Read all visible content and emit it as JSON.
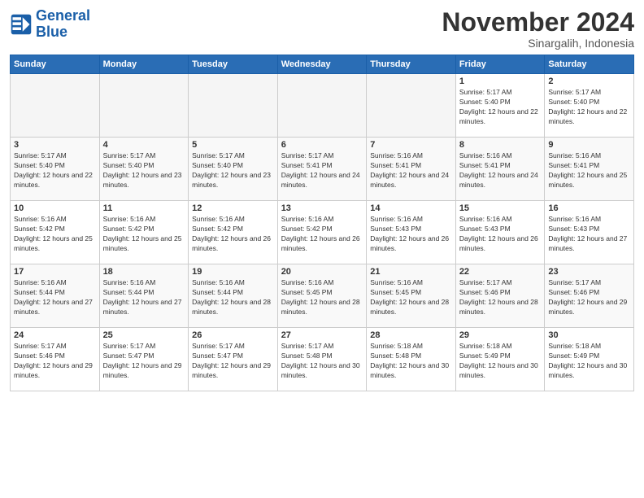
{
  "logo": {
    "line1": "General",
    "line2": "Blue"
  },
  "title": "November 2024",
  "location": "Sinargalih, Indonesia",
  "days_of_week": [
    "Sunday",
    "Monday",
    "Tuesday",
    "Wednesday",
    "Thursday",
    "Friday",
    "Saturday"
  ],
  "weeks": [
    [
      {
        "day": "",
        "empty": true
      },
      {
        "day": "",
        "empty": true
      },
      {
        "day": "",
        "empty": true
      },
      {
        "day": "",
        "empty": true
      },
      {
        "day": "",
        "empty": true
      },
      {
        "day": "1",
        "sunrise": "5:17 AM",
        "sunset": "5:40 PM",
        "daylight": "12 hours and 22 minutes."
      },
      {
        "day": "2",
        "sunrise": "5:17 AM",
        "sunset": "5:40 PM",
        "daylight": "12 hours and 22 minutes."
      }
    ],
    [
      {
        "day": "3",
        "sunrise": "5:17 AM",
        "sunset": "5:40 PM",
        "daylight": "12 hours and 22 minutes."
      },
      {
        "day": "4",
        "sunrise": "5:17 AM",
        "sunset": "5:40 PM",
        "daylight": "12 hours and 23 minutes."
      },
      {
        "day": "5",
        "sunrise": "5:17 AM",
        "sunset": "5:40 PM",
        "daylight": "12 hours and 23 minutes."
      },
      {
        "day": "6",
        "sunrise": "5:17 AM",
        "sunset": "5:41 PM",
        "daylight": "12 hours and 24 minutes."
      },
      {
        "day": "7",
        "sunrise": "5:16 AM",
        "sunset": "5:41 PM",
        "daylight": "12 hours and 24 minutes."
      },
      {
        "day": "8",
        "sunrise": "5:16 AM",
        "sunset": "5:41 PM",
        "daylight": "12 hours and 24 minutes."
      },
      {
        "day": "9",
        "sunrise": "5:16 AM",
        "sunset": "5:41 PM",
        "daylight": "12 hours and 25 minutes."
      }
    ],
    [
      {
        "day": "10",
        "sunrise": "5:16 AM",
        "sunset": "5:42 PM",
        "daylight": "12 hours and 25 minutes."
      },
      {
        "day": "11",
        "sunrise": "5:16 AM",
        "sunset": "5:42 PM",
        "daylight": "12 hours and 25 minutes."
      },
      {
        "day": "12",
        "sunrise": "5:16 AM",
        "sunset": "5:42 PM",
        "daylight": "12 hours and 26 minutes."
      },
      {
        "day": "13",
        "sunrise": "5:16 AM",
        "sunset": "5:42 PM",
        "daylight": "12 hours and 26 minutes."
      },
      {
        "day": "14",
        "sunrise": "5:16 AM",
        "sunset": "5:43 PM",
        "daylight": "12 hours and 26 minutes."
      },
      {
        "day": "15",
        "sunrise": "5:16 AM",
        "sunset": "5:43 PM",
        "daylight": "12 hours and 26 minutes."
      },
      {
        "day": "16",
        "sunrise": "5:16 AM",
        "sunset": "5:43 PM",
        "daylight": "12 hours and 27 minutes."
      }
    ],
    [
      {
        "day": "17",
        "sunrise": "5:16 AM",
        "sunset": "5:44 PM",
        "daylight": "12 hours and 27 minutes."
      },
      {
        "day": "18",
        "sunrise": "5:16 AM",
        "sunset": "5:44 PM",
        "daylight": "12 hours and 27 minutes."
      },
      {
        "day": "19",
        "sunrise": "5:16 AM",
        "sunset": "5:44 PM",
        "daylight": "12 hours and 28 minutes."
      },
      {
        "day": "20",
        "sunrise": "5:16 AM",
        "sunset": "5:45 PM",
        "daylight": "12 hours and 28 minutes."
      },
      {
        "day": "21",
        "sunrise": "5:16 AM",
        "sunset": "5:45 PM",
        "daylight": "12 hours and 28 minutes."
      },
      {
        "day": "22",
        "sunrise": "5:17 AM",
        "sunset": "5:46 PM",
        "daylight": "12 hours and 28 minutes."
      },
      {
        "day": "23",
        "sunrise": "5:17 AM",
        "sunset": "5:46 PM",
        "daylight": "12 hours and 29 minutes."
      }
    ],
    [
      {
        "day": "24",
        "sunrise": "5:17 AM",
        "sunset": "5:46 PM",
        "daylight": "12 hours and 29 minutes."
      },
      {
        "day": "25",
        "sunrise": "5:17 AM",
        "sunset": "5:47 PM",
        "daylight": "12 hours and 29 minutes."
      },
      {
        "day": "26",
        "sunrise": "5:17 AM",
        "sunset": "5:47 PM",
        "daylight": "12 hours and 29 minutes."
      },
      {
        "day": "27",
        "sunrise": "5:17 AM",
        "sunset": "5:48 PM",
        "daylight": "12 hours and 30 minutes."
      },
      {
        "day": "28",
        "sunrise": "5:18 AM",
        "sunset": "5:48 PM",
        "daylight": "12 hours and 30 minutes."
      },
      {
        "day": "29",
        "sunrise": "5:18 AM",
        "sunset": "5:49 PM",
        "daylight": "12 hours and 30 minutes."
      },
      {
        "day": "30",
        "sunrise": "5:18 AM",
        "sunset": "5:49 PM",
        "daylight": "12 hours and 30 minutes."
      }
    ]
  ]
}
